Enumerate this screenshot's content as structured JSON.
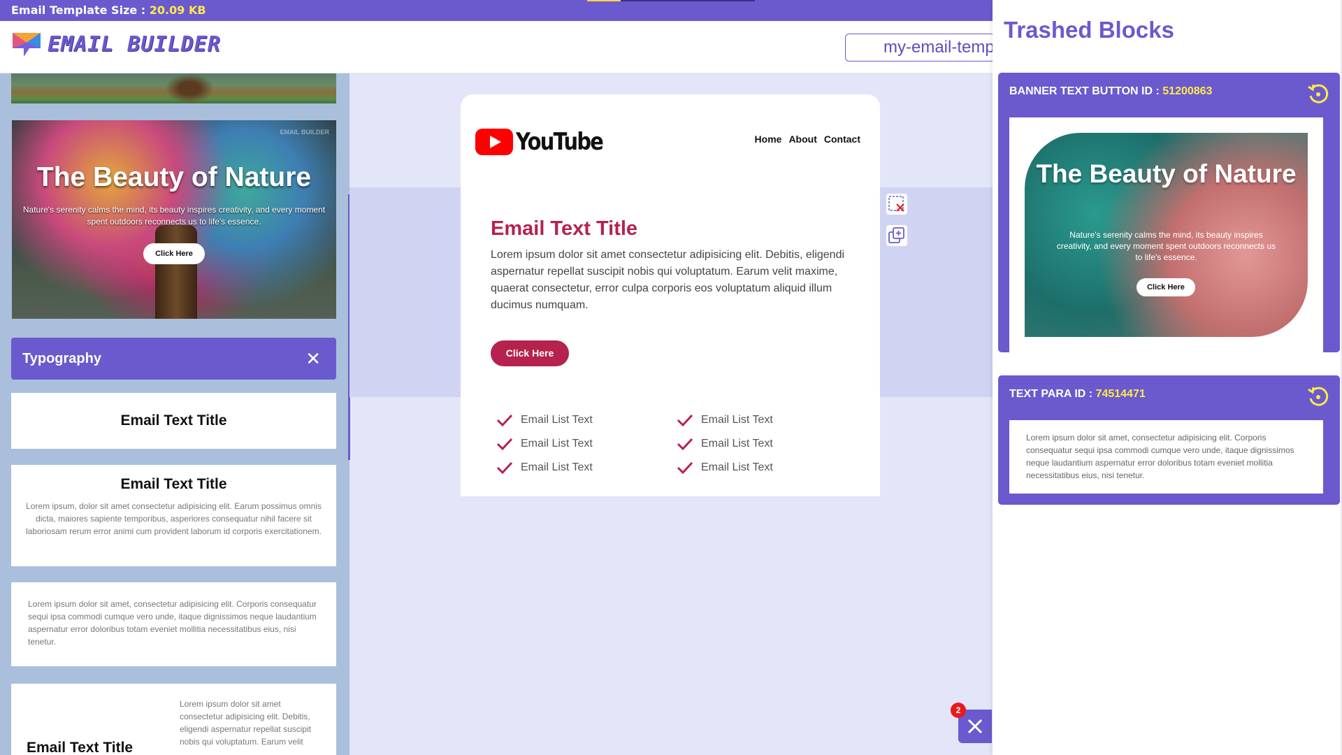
{
  "topbar": {
    "size_label": "Email Template Size :",
    "size_value": "20.09 KB"
  },
  "header": {
    "logo_text": "EMAIL BUILDER",
    "filename": "my-email-temp"
  },
  "left_panel": {
    "nature_card": {
      "title": "The Beauty of Nature",
      "text": "Nature's serenity calms the mind, its beauty inspires creativity, and every moment spent outdoors reconnects us to life's essence.",
      "button": "Click Here",
      "watermark": "EMAIL BUILDER"
    },
    "section_title": "Typography",
    "cards": [
      {
        "title": "Email Text Title"
      },
      {
        "title": "Email Text Title",
        "text": "Lorem ipsum, dolor sit amet consectetur adipisicing elit. Earum possimus omnis dicta, maiores sapiente temporibus, asperiores consequatur nihil facere sit laboriosam rerum error animi cum provident laborum id corporis exercitationem."
      },
      {
        "text": "Lorem ipsum dolor sit amet, consectetur adipisicing elit. Corporis consequatur sequi ipsa commodi cumque vero unde, itaque dignissimos neque laudantium aspernatur error doloribus totam eveniet mollitia necessitatibus eius, nisi tenetur."
      },
      {
        "title": "Email Text Title",
        "text": "Lorem ipsum dolor sit amet consectetur adipisicing elit. Debitis, eligendi aspernatur repellat suscipit nobis qui voluptatum. Earum velit"
      }
    ]
  },
  "email": {
    "brand": "YouTube",
    "nav": [
      "Home",
      "About",
      "Contact"
    ],
    "title": "Email Text Title",
    "body": "Lorem ipsum dolor sit amet consectetur adipisicing elit. Debitis, eligendi aspernatur repellat suscipit nobis qui voluptatum. Earum velit maxime, quaerat consectetur, error culpa corporis eos voluptatum aliquid illum ducimus numquam.",
    "button": "Click Here",
    "list_left": [
      "Email List Text",
      "Email List Text",
      "Email List Text"
    ],
    "list_right": [
      "Email List Text",
      "Email List Text",
      "Email List Text"
    ]
  },
  "tools": {
    "delete_icon": "delete-selection-icon",
    "duplicate_icon": "duplicate-icon"
  },
  "fab": {
    "badge": "2",
    "icon": "close-icon"
  },
  "trash": {
    "title": "Trashed Blocks",
    "blocks": [
      {
        "label": "BANNER TEXT BUTTON ID :",
        "id": "51200863",
        "banner_title": "The Beauty of Nature",
        "banner_text": "Nature's serenity calms the mind, its beauty inspires creativity, and every moment spent outdoors reconnects us to life's essence.",
        "banner_button": "Click Here"
      },
      {
        "label": "TEXT PARA ID :",
        "id": "74514471",
        "text": "Lorem ipsum dolor sit amet, consectetur adipisicing elit. Corporis consequatur sequi ipsa commodi cumque vero unde, itaque dignissimos neque laudantium aspernatur error doloribus totam eveniet mollitia necessitatibus eius, nisi tenetur."
      }
    ]
  },
  "colors": {
    "accent": "#6a5acd",
    "highlight": "#ffe94a",
    "email_accent": "#b5224e",
    "youtube_red": "#ff0000"
  }
}
